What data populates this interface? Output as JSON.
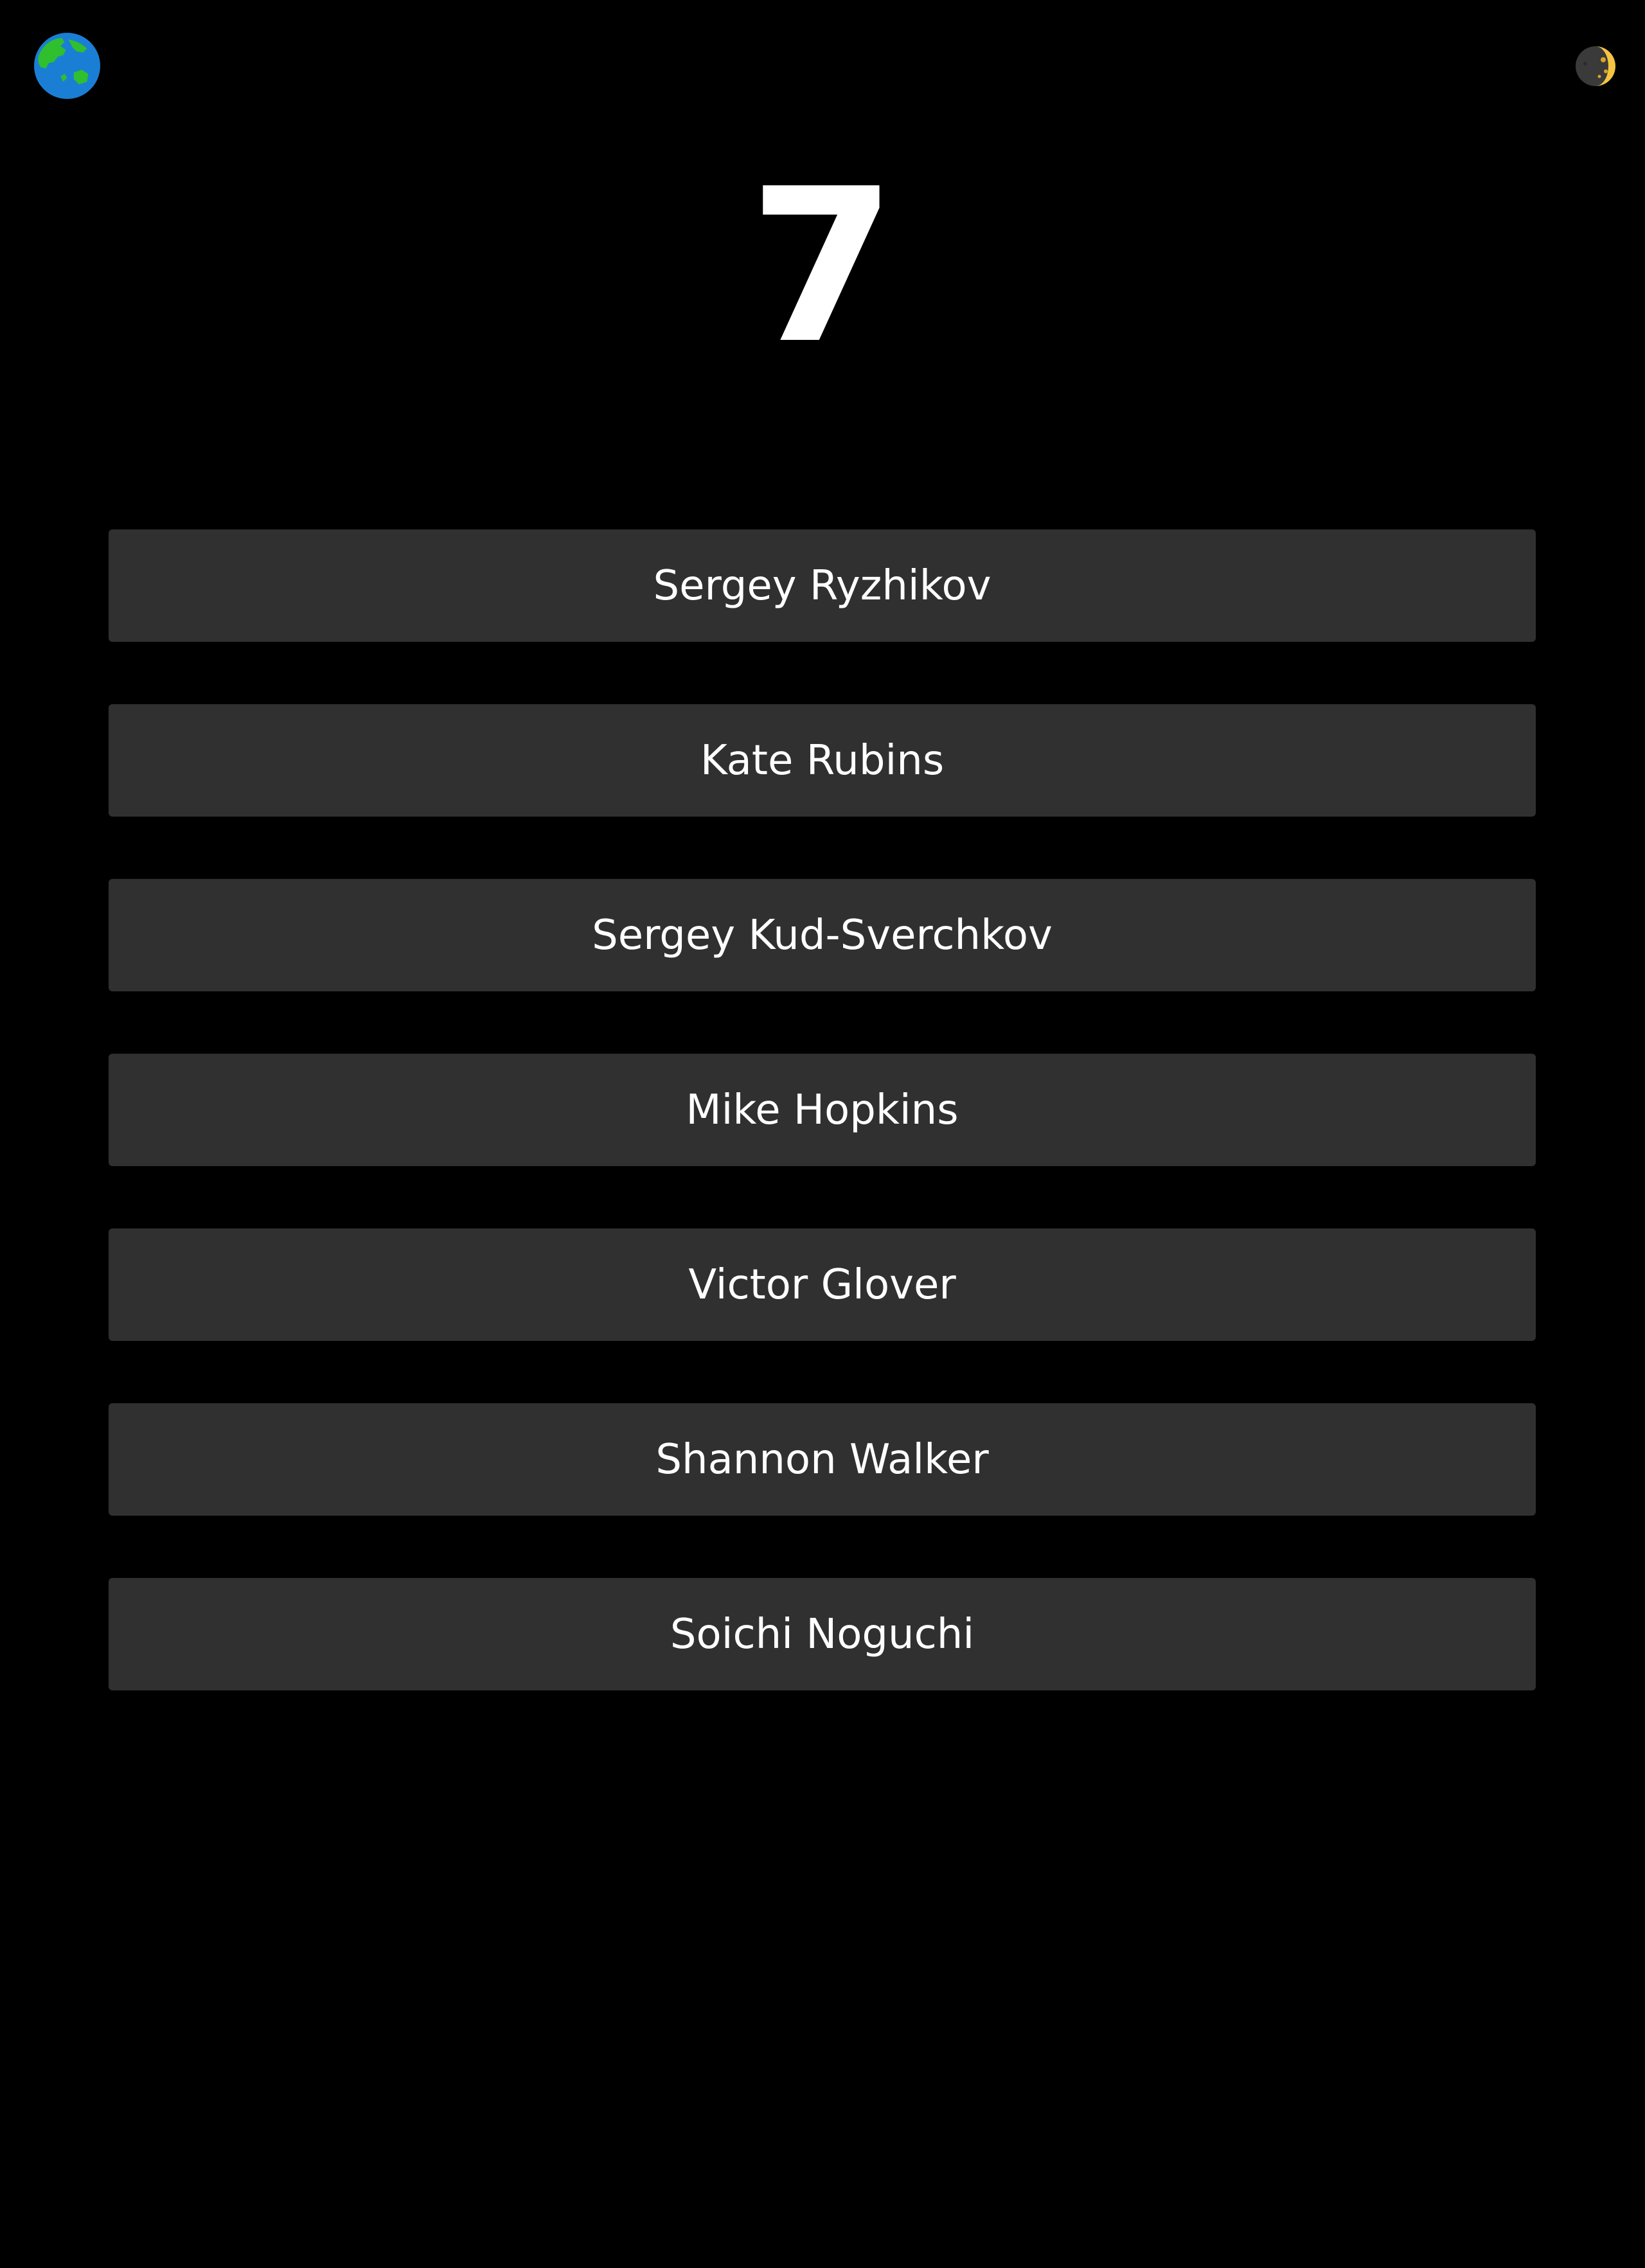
{
  "header": {
    "globe_icon": "globe-asia-australia-icon",
    "theme_icon": "moon-icon"
  },
  "colors": {
    "background": "#000000",
    "item_background": "#303030",
    "text": "#ffffff",
    "globe_ocean": "#1a7fd4",
    "globe_land": "#2fbf2f",
    "moon_light": "#f5c542",
    "moon_dark": "#3a3a3a"
  },
  "count": "7",
  "crew": [
    {
      "name": "Sergey Ryzhikov"
    },
    {
      "name": "Kate Rubins"
    },
    {
      "name": "Sergey Kud-Sverchkov"
    },
    {
      "name": "Mike Hopkins"
    },
    {
      "name": "Victor Glover"
    },
    {
      "name": "Shannon Walker"
    },
    {
      "name": "Soichi Noguchi"
    }
  ]
}
